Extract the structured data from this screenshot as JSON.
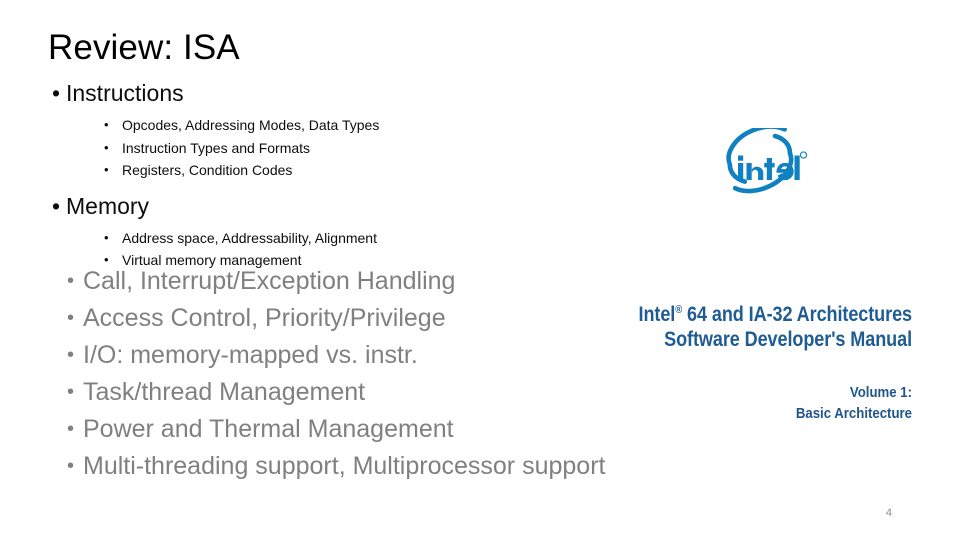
{
  "slide": {
    "title": "Review: ISA",
    "page_number": "4",
    "colors": {
      "title_text": "#000000",
      "body_text": "#0d0d0d",
      "large_bullet_text": "#808080",
      "intel_blue": "#0071c5",
      "manual_blue": "#1f5c94",
      "page_number_gray": "#8c8c8c",
      "background": "#ffffff"
    }
  },
  "outline": {
    "groups": [
      {
        "heading": "Instructions",
        "bullet_char": "•",
        "sub_items": [
          "Opcodes, Addressing Modes, Data Types",
          "Instruction Types and Formats",
          "Registers, Condition Codes"
        ]
      },
      {
        "heading": "Memory",
        "bullet_char": "•",
        "sub_items": [
          "Address space, Addressability, Alignment",
          "Virtual memory management"
        ]
      }
    ],
    "large_items": [
      "Call, Interrupt/Exception Handling",
      "Access Control, Priority/Privilege",
      "I/O: memory-mapped vs. instr.",
      "Task/thread Management",
      "Power and Thermal Management",
      "Multi-threading support, Multiprocessor support"
    ],
    "sub_bullet_char": "•"
  },
  "cover": {
    "logo_name": "intel-logo",
    "logo_wordmark": "intel",
    "logo_trademark": "®",
    "title_line1_prefix": "Intel",
    "title_line1_trademark": "®",
    "title_line1_suffix": " 64 and IA-32 Architectures",
    "title_line2": "Software Developer's Manual",
    "volume_line1": "Volume 1:",
    "volume_line2": "Basic Architecture"
  }
}
